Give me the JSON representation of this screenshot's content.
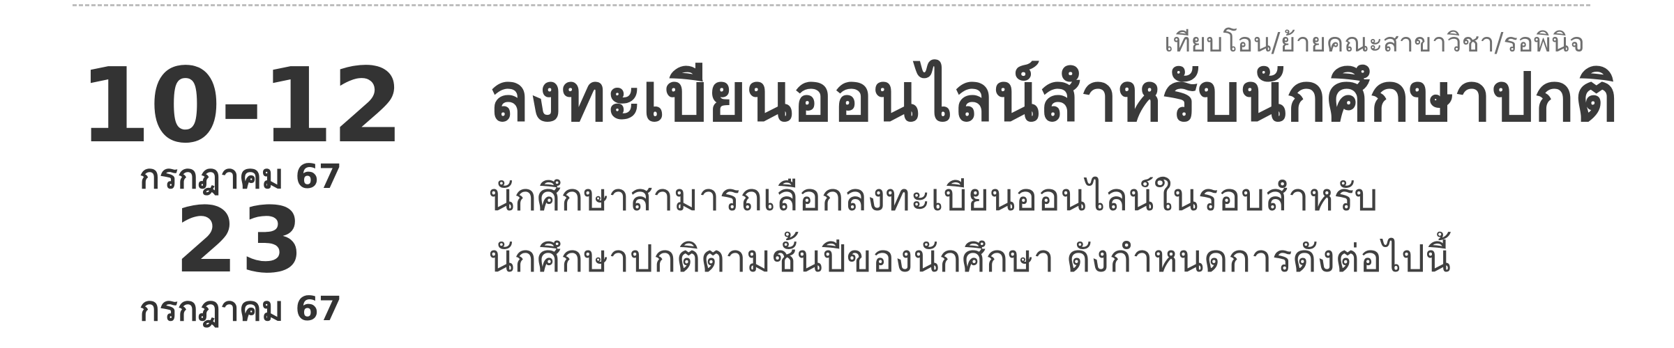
{
  "dates": {
    "range_label": "10-12",
    "range_month": "กรกฎาคม 67",
    "single_day": "23",
    "single_month": "กรกฎาคม 67"
  },
  "tagline": "เทียบโอน/ย้ายคณะสาขาวิชา/รอพินิจ",
  "title": "ลงทะเบียนออนไลน์สำหรับนักศึกษาปกติ",
  "description": {
    "line1": "นักศึกษาสามารถเลือกลงทะเบียนออนไลน์ในรอบสำหรับ",
    "line2": "นักศึกษาปกติตามชั้นปีของนักศึกษา ดังกำหนดการดังต่อไปนี้"
  }
}
